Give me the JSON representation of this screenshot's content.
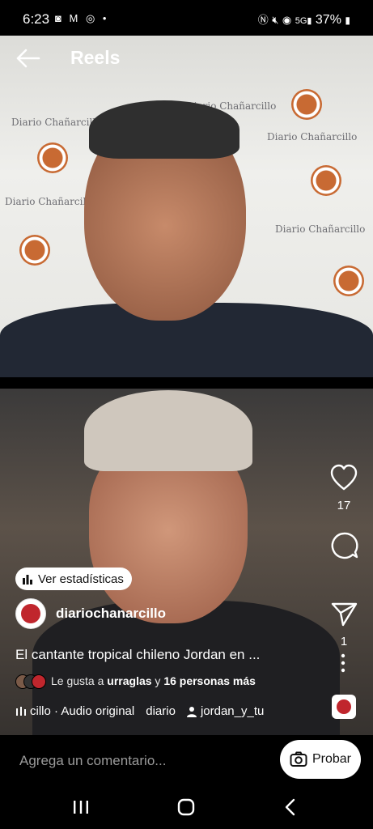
{
  "status_bar": {
    "time": "6:23",
    "battery": "37%",
    "left_icons": [
      "instagram-icon",
      "gmail-icon",
      "whatsapp-icon",
      "dot-icon"
    ],
    "right_icons": [
      "nfc-icon",
      "mute-icon",
      "hotspot-icon",
      "5g-signal-icon",
      "battery-icon"
    ]
  },
  "header": {
    "title": "Reels"
  },
  "wall_text": [
    "Diario Chañarcillo"
  ],
  "actions": {
    "likes_count": "17",
    "comments_count": "",
    "shares_count": "1"
  },
  "stats_button": {
    "label": "Ver estadísticas"
  },
  "account": {
    "username": "diariochanarcillo"
  },
  "caption": "El cantante tropical chileno Jordan en ...",
  "likes_line": {
    "prefix": "Le gusta a",
    "user": "urraglas",
    "connector": "y",
    "others": "16 personas más"
  },
  "audio": {
    "track": "cillo · Audio original",
    "credit": "diario",
    "tagged_user": "jordan_y_tu"
  },
  "comment_bar": {
    "placeholder": "Agrega un comentario...",
    "try_label": "Probar"
  },
  "colors": {
    "brand_red": "#c0262d",
    "wall_orange": "#c86a33",
    "text_gray": "#9a9a9a"
  }
}
